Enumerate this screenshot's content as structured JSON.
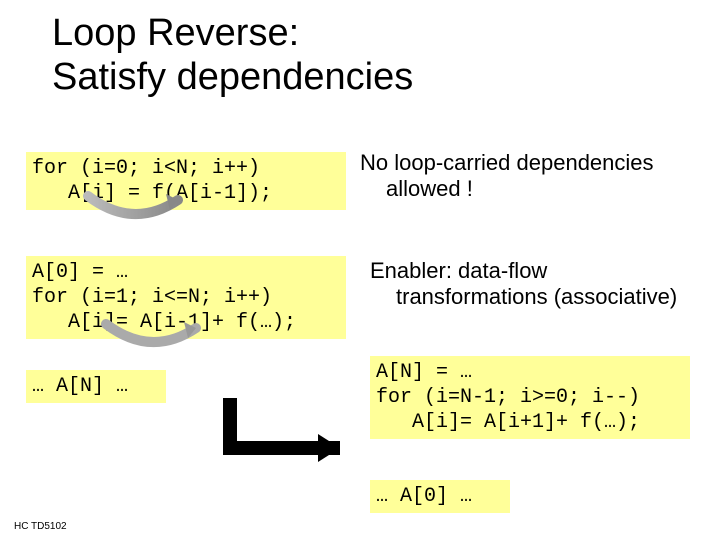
{
  "title_line1": "Loop Reverse:",
  "title_line2": "Satisfy dependencies",
  "code1_line1": "for (i=0; i<N; i++)",
  "code1_line2": "   A[i] = f(A[i-1]);",
  "text1_line1": "No loop-carried dependencies",
  "text1_line2": "allowed !",
  "code2_line1": "A[0] = …",
  "code2_line2": "for (i=1; i<=N; i++)",
  "code2_line3": "   A[i]= A[i-1]+ f(…);",
  "text2_line1": "Enabler: data-flow",
  "text2_line2": "transformations (associative)",
  "code3": "… A[N] …",
  "code4_line1": "A[N] = …",
  "code4_line2": "for (i=N-1; i>=0; i--)",
  "code4_line3": "   A[i]= A[i+1]+ f(…);",
  "code5": "… A[0] …",
  "footer": "HC  TD5102"
}
